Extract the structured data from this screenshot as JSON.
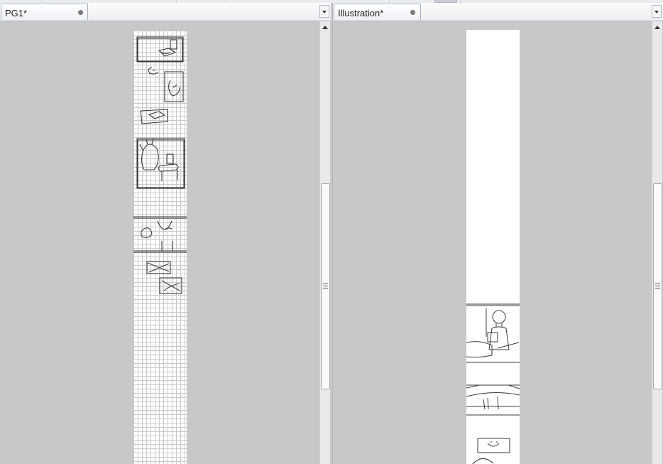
{
  "left_pane": {
    "tab_title": "PG1*"
  },
  "right_pane": {
    "tab_title": "Illustration*"
  },
  "colors": {
    "canvas_background": "#c8c8c8",
    "sheet": "#ffffff",
    "grid": "#c9c9c9",
    "sketch_line": "#3a3a3a"
  },
  "icons": {
    "tab_modified_indicator": "dot",
    "tab_list_menu": "chevron-down-icon",
    "scroll_up": "arrow-up-icon",
    "scroll_grip": "grip-icon"
  }
}
